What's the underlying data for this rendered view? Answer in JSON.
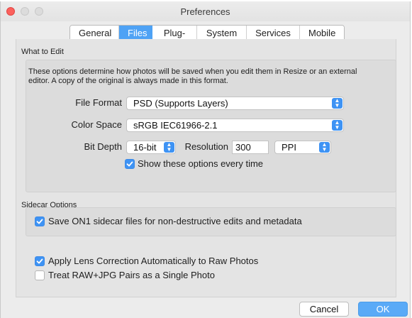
{
  "window": {
    "title": "Preferences"
  },
  "tabs": [
    {
      "label": "General"
    },
    {
      "label": "Files"
    },
    {
      "label": "Plug-ins"
    },
    {
      "label": "System"
    },
    {
      "label": "Services"
    },
    {
      "label": "Mobile"
    }
  ],
  "active_tab": "Files",
  "what_to_edit": {
    "heading": "What to Edit",
    "description_line1": "These options determine how photos will be saved when you edit them in Resize or an external",
    "description_line2": "editor.  A copy of the original is always made in this format.",
    "file_format": {
      "label": "File Format",
      "value": "PSD (Supports Layers)"
    },
    "color_space": {
      "label": "Color Space",
      "value": "sRGB IEC61966-2.1"
    },
    "bit_depth": {
      "label": "Bit Depth",
      "value": "16-bit"
    },
    "resolution": {
      "label": "Resolution",
      "value": "300",
      "unit": "PPI"
    },
    "show_options": {
      "label": "Show these options every time",
      "checked": true
    }
  },
  "sidecar": {
    "heading": "Sidecar Options",
    "save_sidecar": {
      "label": "Save ON1 sidecar files for non-destructive edits and metadata",
      "checked": true
    }
  },
  "options": {
    "apply_lens": {
      "label": "Apply Lens Correction Automatically to Raw Photos",
      "checked": true
    },
    "treat_pairs": {
      "label": "Treat RAW+JPG Pairs as a Single Photo",
      "checked": false
    }
  },
  "buttons": {
    "cancel": "Cancel",
    "ok": "OK"
  },
  "colors": {
    "accent": "#3e93f4",
    "tab_active": "#4ea2f5",
    "close": "#fc615d"
  },
  "icons": {
    "stepper": "up-down-chevron-icon",
    "check": "checkmark-icon"
  }
}
